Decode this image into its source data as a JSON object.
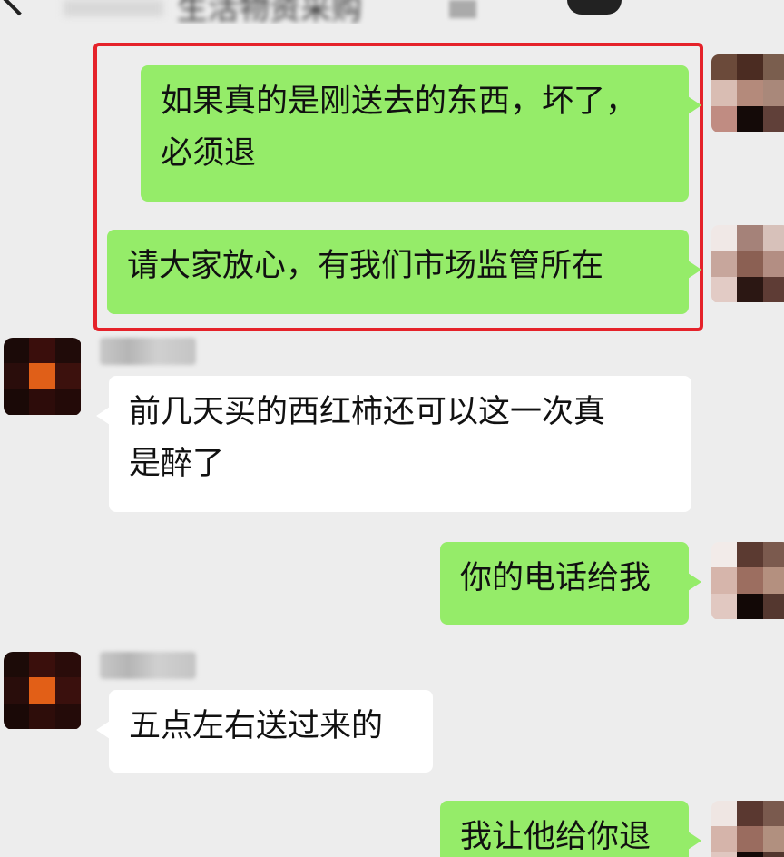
{
  "header": {
    "title": "生活物资采购",
    "back_icon": "chevron-left-icon"
  },
  "highlight_color": "#e5222a",
  "colors": {
    "background": "#ededed",
    "outgoing_bubble": "#95ec69",
    "incoming_bubble": "#ffffff"
  },
  "messages": [
    {
      "direction": "out",
      "lines": [
        "如果真的是刚送去的东西，坏了，",
        "必须退"
      ]
    },
    {
      "direction": "out",
      "lines": [
        "请大家放心，有我们市场监管所在"
      ]
    },
    {
      "direction": "in",
      "lines": [
        "前几天买的西红柿还可以这一次真",
        "是醉了"
      ]
    },
    {
      "direction": "out",
      "lines": [
        "你的电话给我"
      ]
    },
    {
      "direction": "in",
      "lines": [
        "五点左右送过来的"
      ]
    },
    {
      "direction": "out",
      "lines": [
        "我让他给你退"
      ]
    }
  ]
}
